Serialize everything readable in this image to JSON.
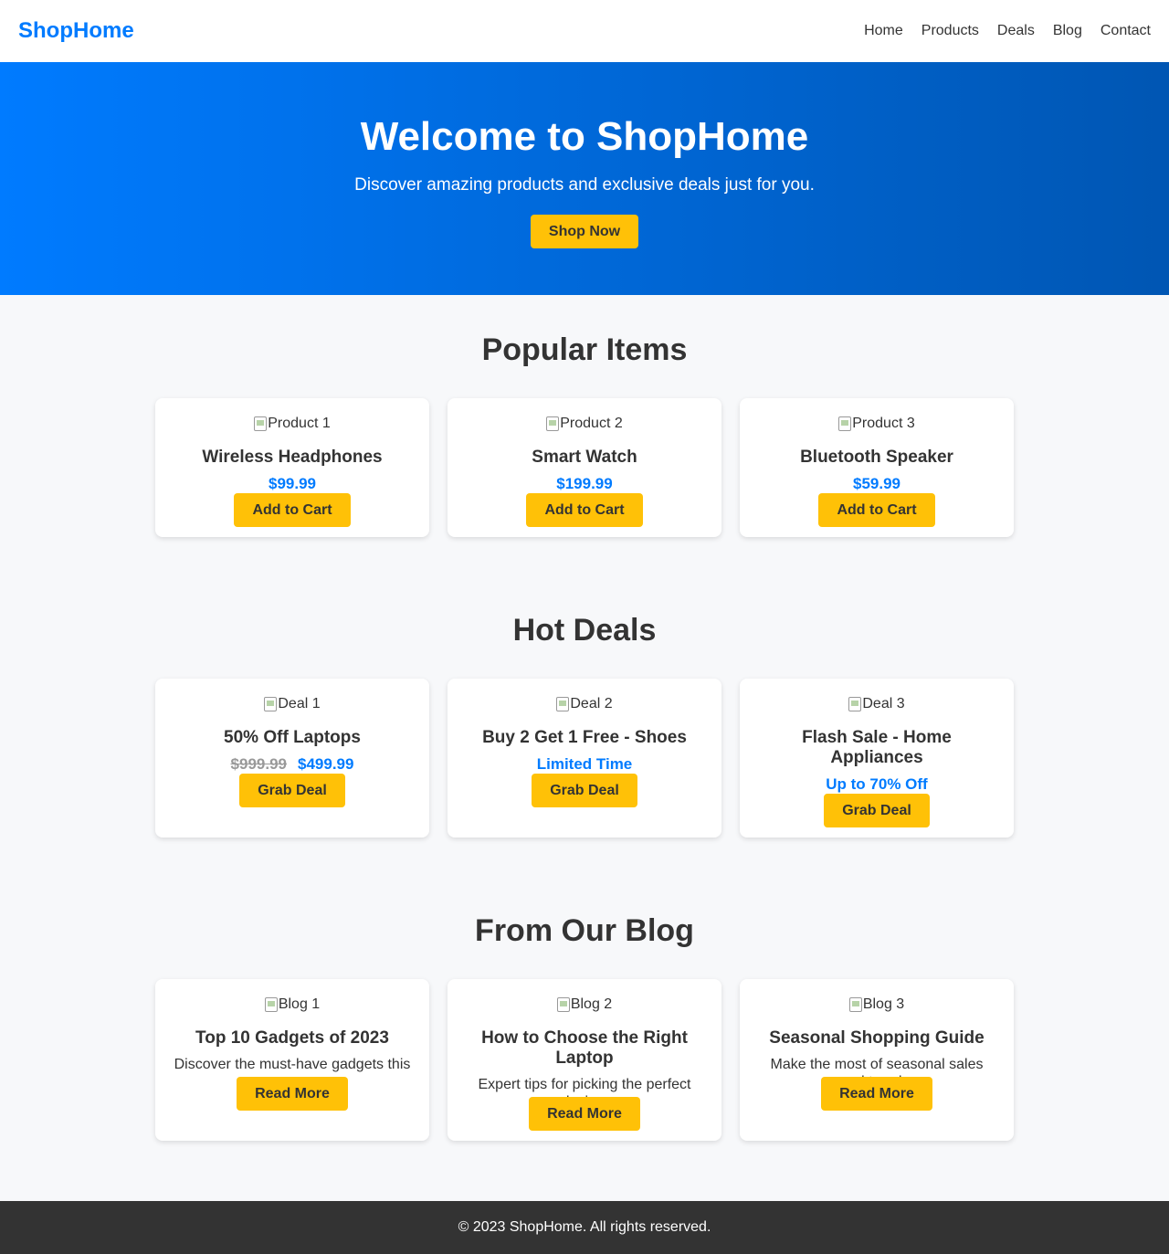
{
  "header": {
    "brand": "ShopHome",
    "nav": [
      "Home",
      "Products",
      "Deals",
      "Blog",
      "Contact"
    ]
  },
  "hero": {
    "title": "Welcome to ShopHome",
    "subtitle": "Discover amazing products and exclusive deals just for you.",
    "cta": "Shop Now"
  },
  "popular": {
    "heading": "Popular Items",
    "items": [
      {
        "img_alt": "Product 1",
        "name": "Wireless Headphones",
        "price": "$99.99",
        "button": "Add to Cart"
      },
      {
        "img_alt": "Product 2",
        "name": "Smart Watch",
        "price": "$199.99",
        "button": "Add to Cart"
      },
      {
        "img_alt": "Product 3",
        "name": "Bluetooth Speaker",
        "price": "$59.99",
        "button": "Add to Cart"
      }
    ]
  },
  "deals": {
    "heading": "Hot Deals",
    "items": [
      {
        "img_alt": "Deal 1",
        "name": "50% Off Laptops",
        "old_price": "$999.99",
        "price": "$499.99",
        "button": "Grab Deal"
      },
      {
        "img_alt": "Deal 2",
        "name": "Buy 2 Get 1 Free - Shoes",
        "price": "Limited Time",
        "button": "Grab Deal"
      },
      {
        "img_alt": "Deal 3",
        "name": "Flash Sale - Home Appliances",
        "price": "Up to 70% Off",
        "button": "Grab Deal"
      }
    ]
  },
  "blog": {
    "heading": "From Our Blog",
    "items": [
      {
        "img_alt": "Blog 1",
        "title": "Top 10 Gadgets of 2023",
        "excerpt": "Discover the must-have gadgets this year.",
        "button": "Read More"
      },
      {
        "img_alt": "Blog 2",
        "title": "How to Choose the Right Laptop",
        "excerpt": "Expert tips for picking the perfect device.",
        "button": "Read More"
      },
      {
        "img_alt": "Blog 3",
        "title": "Seasonal Shopping Guide",
        "excerpt": "Make the most of seasonal sales and trends.",
        "button": "Read More"
      }
    ]
  },
  "footer": {
    "text": "© 2023 ShopHome. All rights reserved."
  },
  "colors": {
    "brand": "#007bff",
    "accent": "#ffc107",
    "footer_bg": "#333333"
  }
}
